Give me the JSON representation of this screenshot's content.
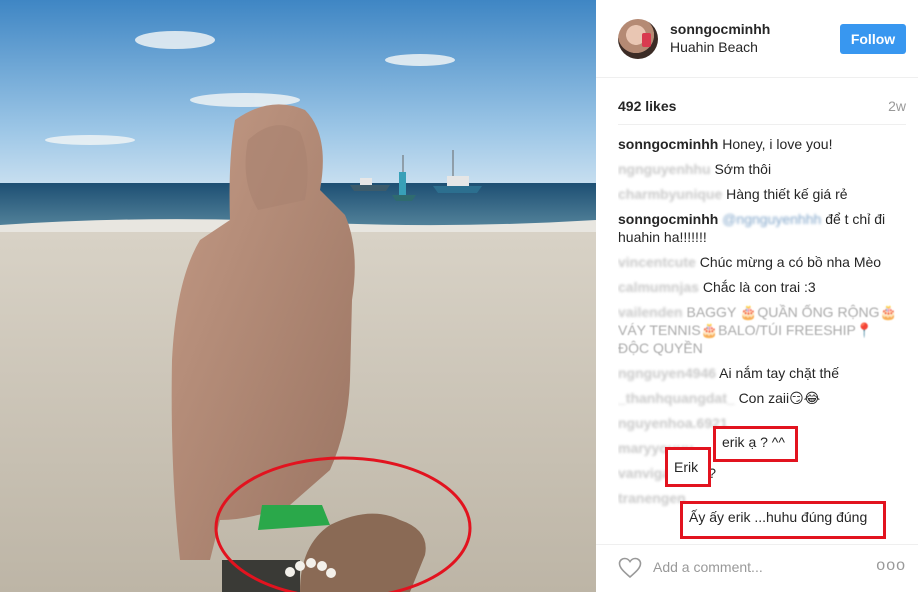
{
  "post": {
    "username": "sonngocminhh",
    "location": "Huahin Beach",
    "follow_label": "Follow",
    "likes": "492 likes",
    "age": "2w"
  },
  "comments": [
    {
      "user": "sonngocminhh",
      "text": "Honey, i love you!",
      "user_blurred": false
    },
    {
      "user": "ngnguyenhhu",
      "text": "Sớm thôi",
      "user_blurred": true
    },
    {
      "user": "charmbyunique",
      "text": "Hàng thiết kế giá rẻ",
      "user_blurred": true
    },
    {
      "user": "sonngocminhh",
      "mention": "@ngnguyenhhh",
      "text": "để t chỉ đi huahin ha!!!!!!!",
      "user_blurred": false
    },
    {
      "user": "vincentcute",
      "text": "Chúc mừng a có bồ nha Mèo",
      "user_blurred": true
    },
    {
      "user": "calmumnjas",
      "text": "Chắc là con trai :3",
      "user_blurred": true
    },
    {
      "user": "vailenden",
      "text": "BAGGY 🎂QUẦN ỐNG RỘNG🎂VÁY TENNIS🎂BALO/TÚI FREESHIP📍ĐỘC QUYỀN",
      "user_blurred": true,
      "faded": true
    },
    {
      "user": "ngnguyen4946",
      "text": "Ai nắm tay chặt thế",
      "user_blurred": true
    },
    {
      "user": "_thanhquangdat_",
      "text": "Con zaii😏😂",
      "user_blurred": true
    },
    {
      "user": "nguyenhoa.6921",
      "text": "",
      "user_blurred": true
    },
    {
      "user": "maryyouuu",
      "text": "",
      "user_blurred": true
    },
    {
      "user": "vanviganh",
      "text": "Be?",
      "user_blurred": true
    },
    {
      "user": "tranengen",
      "text": "",
      "user_blurred": true
    }
  ],
  "highlights": {
    "erik_question": "erik ạ ? ^^",
    "erik": "Erik",
    "ay_ay": "Ấy ấy erik ...huhu đúng đúng"
  },
  "comment_bar": {
    "placeholder": "Add a comment...",
    "more": "ooo"
  },
  "icons": {
    "heart": "heart-icon",
    "more": "more-options-icon"
  },
  "colors": {
    "follow_button": "#3897f0",
    "highlight_box": "#e2131f",
    "annotation_ellipse": "#e2131f"
  }
}
